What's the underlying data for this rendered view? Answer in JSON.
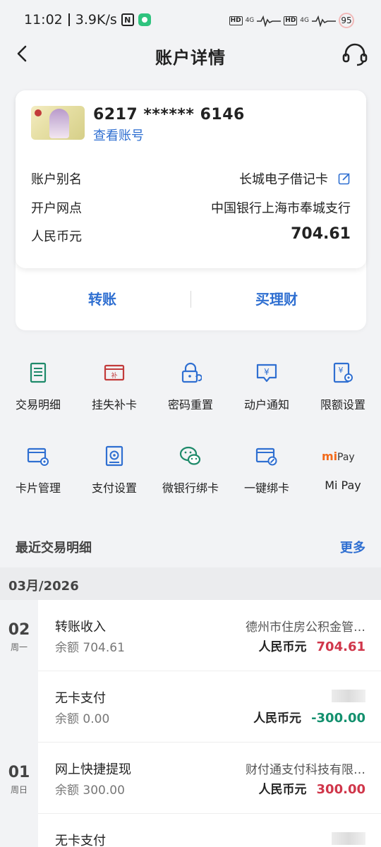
{
  "status_bar": {
    "time": "11:02",
    "speed": "3.9K/s",
    "sim1": "4G",
    "sim2": "4G",
    "battery": "95"
  },
  "header": {
    "title": "账户详情"
  },
  "account": {
    "card_number": "6217 ****** 6146",
    "view_account_label": "查看账号",
    "alias_label": "账户别名",
    "alias_value": "长城电子借记卡",
    "branch_label": "开户网点",
    "branch_value": "中国银行上海市奉城支行",
    "currency_label": "人民币元",
    "balance": "704.61",
    "transfer_label": "转账",
    "wealth_label": "买理财"
  },
  "quick_actions": [
    {
      "label": "交易明细",
      "icon": "list-icon"
    },
    {
      "label": "挂失补卡",
      "icon": "card-replace-icon"
    },
    {
      "label": "密码重置",
      "icon": "lock-reset-icon"
    },
    {
      "label": "动户通知",
      "icon": "yuan-notify-icon"
    },
    {
      "label": "限额设置",
      "icon": "yuan-settings-icon"
    },
    {
      "label": "卡片管理",
      "icon": "card-settings-icon"
    },
    {
      "label": "支付设置",
      "icon": "payment-settings-icon"
    },
    {
      "label": "微银行绑卡",
      "icon": "wechat-icon"
    },
    {
      "label": "一键绑卡",
      "icon": "card-link-icon"
    },
    {
      "label": "Mi Pay",
      "icon": "mipay-icon"
    }
  ],
  "recent": {
    "title": "最近交易明细",
    "more_label": "更多",
    "month": "03月/2026",
    "days": [
      {
        "day": "02",
        "weekday": "周一"
      },
      {
        "day": "01",
        "weekday": "周日"
      }
    ],
    "transactions": [
      {
        "title": "转账收入",
        "balance": "余额 704.61",
        "party": "德州市住房公积金管…",
        "currency": "人民币元",
        "amount": "704.61",
        "direction": "in"
      },
      {
        "title": "无卡支付",
        "balance": "余额 0.00",
        "party": "",
        "currency": "人民币元",
        "amount": "-300.00",
        "direction": "out"
      },
      {
        "title": "网上快捷提现",
        "balance": "余额 300.00",
        "party": "财付通支付科技有限…",
        "currency": "人民币元",
        "amount": "300.00",
        "direction": "in"
      },
      {
        "title": "无卡支付",
        "balance": "",
        "party": "",
        "currency": "",
        "amount": "",
        "direction": "out"
      }
    ]
  },
  "colors": {
    "accent": "#2f6fd1",
    "income": "#d0364a",
    "expense": "#13906e",
    "icon_green": "#1e8a6a",
    "icon_red": "#c23b3b",
    "icon_blue": "#2f6fd1"
  }
}
